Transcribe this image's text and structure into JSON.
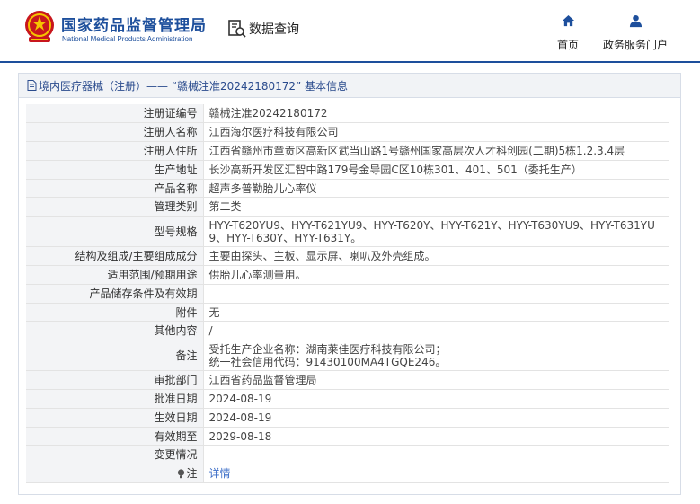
{
  "header": {
    "site_title": "国家药品监督管理局",
    "site_subtitle": "National Medical Products Administration",
    "data_query": "数据查询",
    "nav": [
      {
        "label": "首页",
        "icon": "home-icon"
      },
      {
        "label": "政务服务门户",
        "icon": "user-icon"
      }
    ],
    "brand_color": "#1d4f9c",
    "emblem_color": "#c8161d"
  },
  "panel": {
    "breadcrumb": "境内医疗器械（注册）",
    "title": " —— “赣械注准20242180172” 基本信息"
  },
  "fields": [
    {
      "label": "注册证编号",
      "value": "赣械注准20242180172"
    },
    {
      "label": "注册人名称",
      "value": "江西海尔医疗科技有限公司"
    },
    {
      "label": "注册人住所",
      "value": "江西省赣州市章贡区高新区武当山路1号赣州国家高层次人才科创园(二期)5栋1.2.3.4层"
    },
    {
      "label": "生产地址",
      "value": "长沙高新开发区汇智中路179号金导园C区10栋301、401、501（委托生产）"
    },
    {
      "label": "产品名称",
      "value": "超声多普勒胎儿心率仪"
    },
    {
      "label": "管理类别",
      "value": "第二类"
    },
    {
      "label": "型号规格",
      "value": "HYY-T620YU9、HYY-T621YU9、HYY-T620Y、HYY-T621Y、HYY-T630YU9、HYY-T631YU9、HYY-T630Y、HYY-T631Y。"
    },
    {
      "label": "结构及组成/主要组成成分",
      "value": "主要由探头、主板、显示屏、喇叭及外壳组成。"
    },
    {
      "label": "适用范围/预期用途",
      "value": "供胎儿心率测量用。"
    },
    {
      "label": "产品储存条件及有效期",
      "value": ""
    },
    {
      "label": "附件",
      "value": "无"
    },
    {
      "label": "其他内容",
      "value": "/"
    },
    {
      "label": "备注",
      "value_lines": [
        "受托生产企业名称：湖南莱佳医疗科技有限公司；",
        "统一社会信用代码：91430100MA4TGQE246。"
      ]
    },
    {
      "label": "审批部门",
      "value": "江西省药品监督管理局"
    },
    {
      "label": "批准日期",
      "value": "2024-08-19"
    },
    {
      "label": "生效日期",
      "value": "2024-08-19"
    },
    {
      "label": "有效期至",
      "value": "2029-08-18"
    },
    {
      "label": "变更情况",
      "value": ""
    }
  ],
  "note": {
    "label": "注",
    "link": "详情",
    "icon": "bulb-icon"
  }
}
